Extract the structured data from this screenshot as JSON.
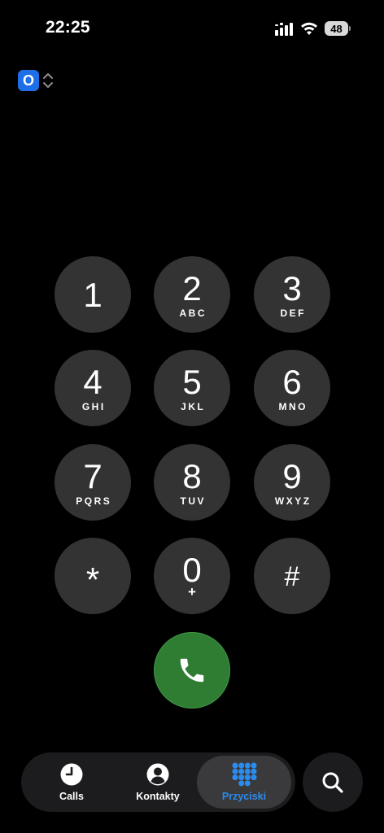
{
  "status_bar": {
    "time": "22:25",
    "battery": "48",
    "icons": [
      "signal-icon",
      "wifi-icon",
      "battery-icon"
    ]
  },
  "sim_selector": {
    "label": "O",
    "accent": "#1e6ee8"
  },
  "keypad": {
    "keys": [
      {
        "digit": "1",
        "letters": ""
      },
      {
        "digit": "2",
        "letters": "ABC"
      },
      {
        "digit": "3",
        "letters": "DEF"
      },
      {
        "digit": "4",
        "letters": "GHI"
      },
      {
        "digit": "5",
        "letters": "JKL"
      },
      {
        "digit": "6",
        "letters": "MNO"
      },
      {
        "digit": "7",
        "letters": "PQRS"
      },
      {
        "digit": "8",
        "letters": "TUV"
      },
      {
        "digit": "9",
        "letters": "WXYZ"
      },
      {
        "digit": "*",
        "letters": ""
      },
      {
        "digit": "0",
        "letters": "+"
      },
      {
        "digit": "#",
        "letters": ""
      }
    ],
    "key_color": "#333333",
    "call_color": "#2f7d33"
  },
  "tab_bar": {
    "tabs": [
      {
        "label": "Calls",
        "icon": "clock-icon",
        "active": false
      },
      {
        "label": "Kontakty",
        "icon": "person-icon",
        "active": false
      },
      {
        "label": "Przyciski",
        "icon": "keypad-grid-icon",
        "active": true
      }
    ],
    "active_color": "#2b8cf0",
    "search_icon": "search-icon"
  }
}
